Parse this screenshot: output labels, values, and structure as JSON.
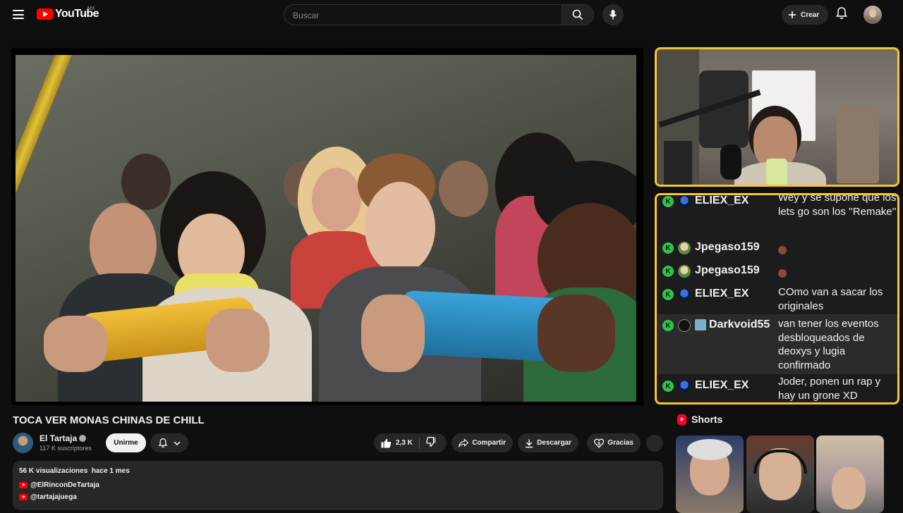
{
  "header": {
    "logo_text": "YouTube",
    "region": "MX",
    "search_placeholder": "Buscar",
    "create_label": "Crear"
  },
  "video": {
    "title": "TOCA VER MONAS CHINAS DE CHILL"
  },
  "channel": {
    "name": "El Tartaja",
    "subscribers": "117 K suscriptores",
    "join_label": "Unirme"
  },
  "actions": {
    "likes": "2,3 K",
    "share_label": "Compartir",
    "download_label": "Descargar",
    "thanks_label": "Gracias"
  },
  "description": {
    "views": "56 K visualizaciones",
    "date": "hace 1 mes",
    "links": [
      "@ElRinconDeTartaja",
      "@tartajajuega"
    ]
  },
  "chat": [
    {
      "user": "ELIEX_EX",
      "text": "Wey y se supone que los lets go son los ''Remake''",
      "avatar": "blue-mask-icon"
    },
    {
      "user": "Jpegaso159",
      "text": "",
      "emote": true,
      "avatar": "pegasus-icon"
    },
    {
      "user": "Jpegaso159",
      "text": "",
      "emote": true,
      "avatar": "pegasus-icon"
    },
    {
      "user": "ELIEX_EX",
      "text": "COmo van a sacar los originales",
      "avatar": "blue-mask-icon"
    },
    {
      "user": "Darkvoid55",
      "text": "van tener los eventos desbloqueados de deoxys y lugia confirmado",
      "avatar": "user-icon"
    },
    {
      "user": "ELIEX_EX",
      "text": "Joder, ponen un rap y hay un grone XD",
      "avatar": "blue-mask-icon"
    }
  ],
  "shorts": {
    "title": "Shorts"
  },
  "colors": {
    "accent": "#f7c531",
    "brand_red": "#ff0000",
    "chat_badge": "#2ec44a"
  }
}
